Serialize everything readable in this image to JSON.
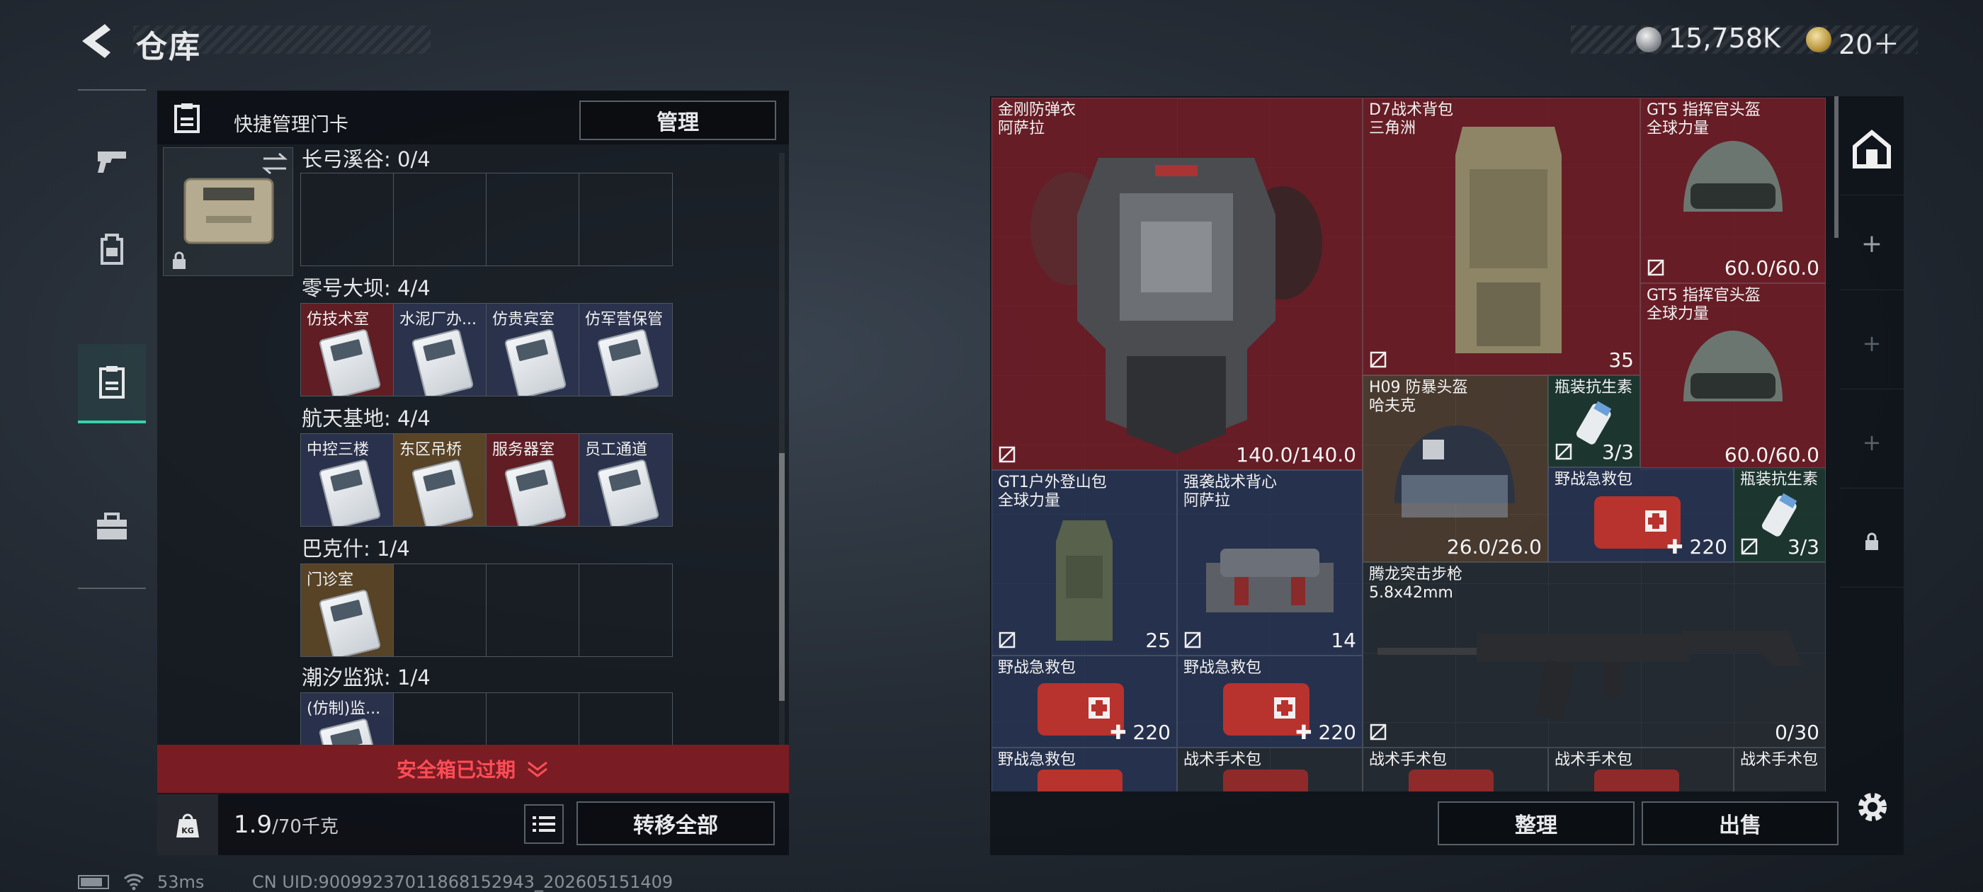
{
  "header": {
    "title": "仓库",
    "currency1": "15,758K",
    "currency2": "20＋",
    "small_text": "..."
  },
  "nav": {
    "items": [
      {
        "icon": "pistol-icon"
      },
      {
        "icon": "backpack-icon"
      },
      {
        "icon": "keycard-icon"
      },
      {
        "icon": "toolbox-icon"
      }
    ]
  },
  "keycard_panel": {
    "head_label": "快捷管理门卡",
    "manage_label": "管理",
    "regions": [
      {
        "label": "长弓溪谷: 0/4",
        "cards": [
          "",
          "",
          "",
          ""
        ]
      },
      {
        "label": "零号大坝: 4/4",
        "cards": [
          "仿技术室",
          "水泥厂办...",
          "仿贵宾室",
          "仿军营保管"
        ]
      },
      {
        "label": "航天基地: 4/4",
        "cards": [
          "中控三楼",
          "东区吊桥",
          "服务器室",
          "员工通道"
        ]
      },
      {
        "label": "巴克什: 1/4",
        "cards": [
          "门诊室",
          "",
          "",
          ""
        ]
      },
      {
        "label": "潮汐监狱: 1/4",
        "cards": [
          "(仿制)监...",
          "",
          "",
          ""
        ]
      }
    ],
    "expired_label": "安全箱已过期",
    "weight_value": "1.9",
    "weight_max": "/70千克",
    "transfer_label": "转移全部"
  },
  "stash": {
    "items": [
      {
        "name": "金刚防弹衣\n阿萨拉",
        "value": "140.0/140.0"
      },
      {
        "name": "D7战术背包\n三角洲",
        "value": "35"
      },
      {
        "name": "GT5 指挥官头盔\n全球力量",
        "value": "60.0/60.0"
      },
      {
        "name": "GT5 指挥官头盔\n全球力量",
        "value": "60.0/60.0"
      },
      {
        "name": "H09 防暴头盔\n哈夫克",
        "value": "26.0/26.0"
      },
      {
        "name": "瓶装抗生素",
        "value": "3/3"
      },
      {
        "name": "野战急救包",
        "value": "220"
      },
      {
        "name": "瓶装抗生素",
        "value": "3/3"
      },
      {
        "name": "GT1户外登山包\n全球力量",
        "value": "25"
      },
      {
        "name": "强袭战术背心\n阿萨拉",
        "value": "14"
      },
      {
        "name": "腾龙突击步枪\n5.8x42mm",
        "value": "0/30"
      },
      {
        "name": "野战急救包",
        "value": "220"
      },
      {
        "name": "野战急救包",
        "value": "220"
      },
      {
        "name": "野战急救包",
        "value": ""
      },
      {
        "name": "战术手术包",
        "value": ""
      },
      {
        "name": "战术手术包",
        "value": ""
      },
      {
        "name": "战术手术包",
        "value": ""
      },
      {
        "name": "战术手术包",
        "value": ""
      }
    ],
    "sort_label": "整理",
    "sell_label": "出售"
  },
  "status_bar": {
    "ping": "53ms",
    "uid": "CN UID:9009923701186815294​3_202605151409"
  }
}
